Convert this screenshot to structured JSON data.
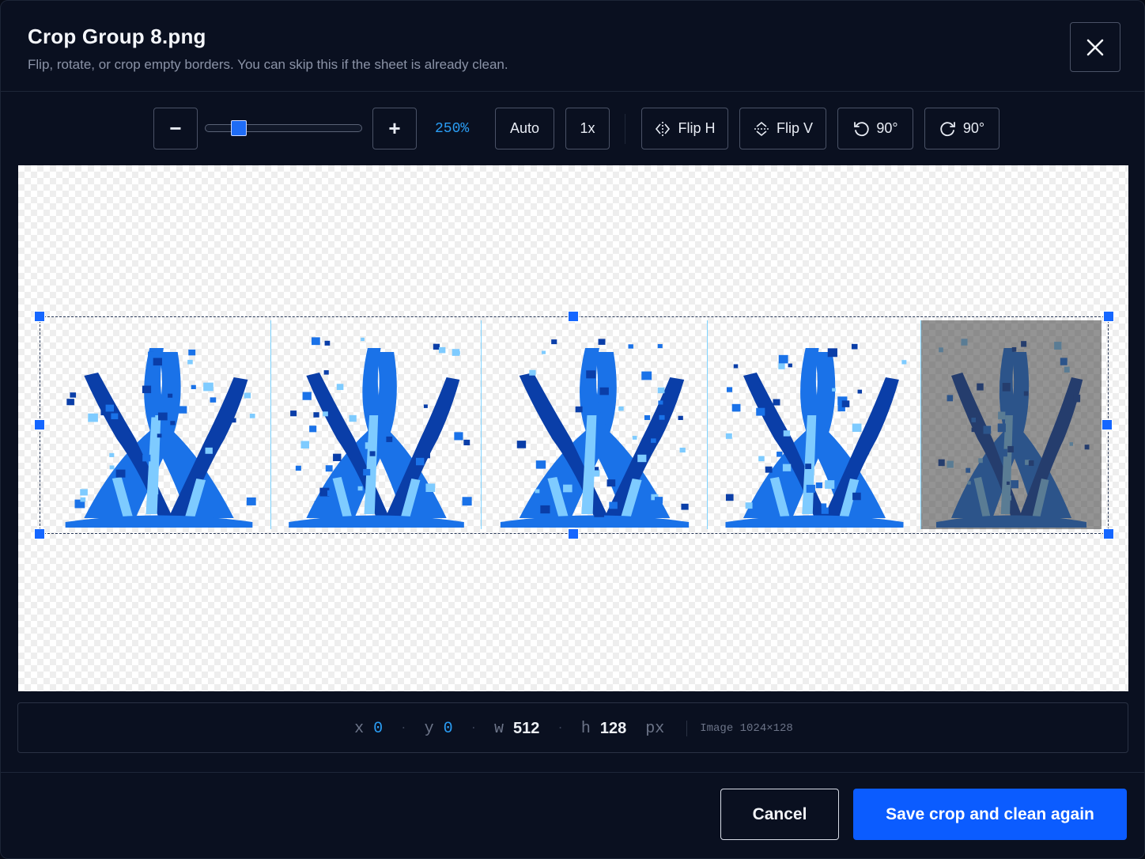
{
  "dialog": {
    "title": "Crop Group 8.png",
    "subtitle": "Flip, rotate, or crop empty borders. You can skip this if the sheet is already clean."
  },
  "toolbar": {
    "zoom_out_label": "−",
    "zoom_in_label": "+",
    "zoom_level": "250%",
    "zoom_slider_fraction": 0.2,
    "auto_label": "Auto",
    "one_x_label": "1x",
    "flip_h_label": "Flip H",
    "flip_v_label": "Flip V",
    "rotate_ccw_label": "90°",
    "rotate_cw_label": "90°"
  },
  "sheet": {
    "frame_count": 5,
    "sprite_color": "#1a72e8",
    "sprite_highlight": "#7ecbff",
    "sprite_dark": "#0a3ea8"
  },
  "info": {
    "x_label": "x",
    "x_value": "0",
    "y_label": "y",
    "y_value": "0",
    "w_label": "w",
    "w_value": "512",
    "h_label": "h",
    "h_value": "128",
    "unit": "px",
    "image_size": "Image 1024×128"
  },
  "footer": {
    "cancel_label": "Cancel",
    "save_label": "Save crop and clean again"
  },
  "colors": {
    "accent": "#0b5cff",
    "zoom_text": "#2a9df4",
    "handle": "#1466ff"
  }
}
